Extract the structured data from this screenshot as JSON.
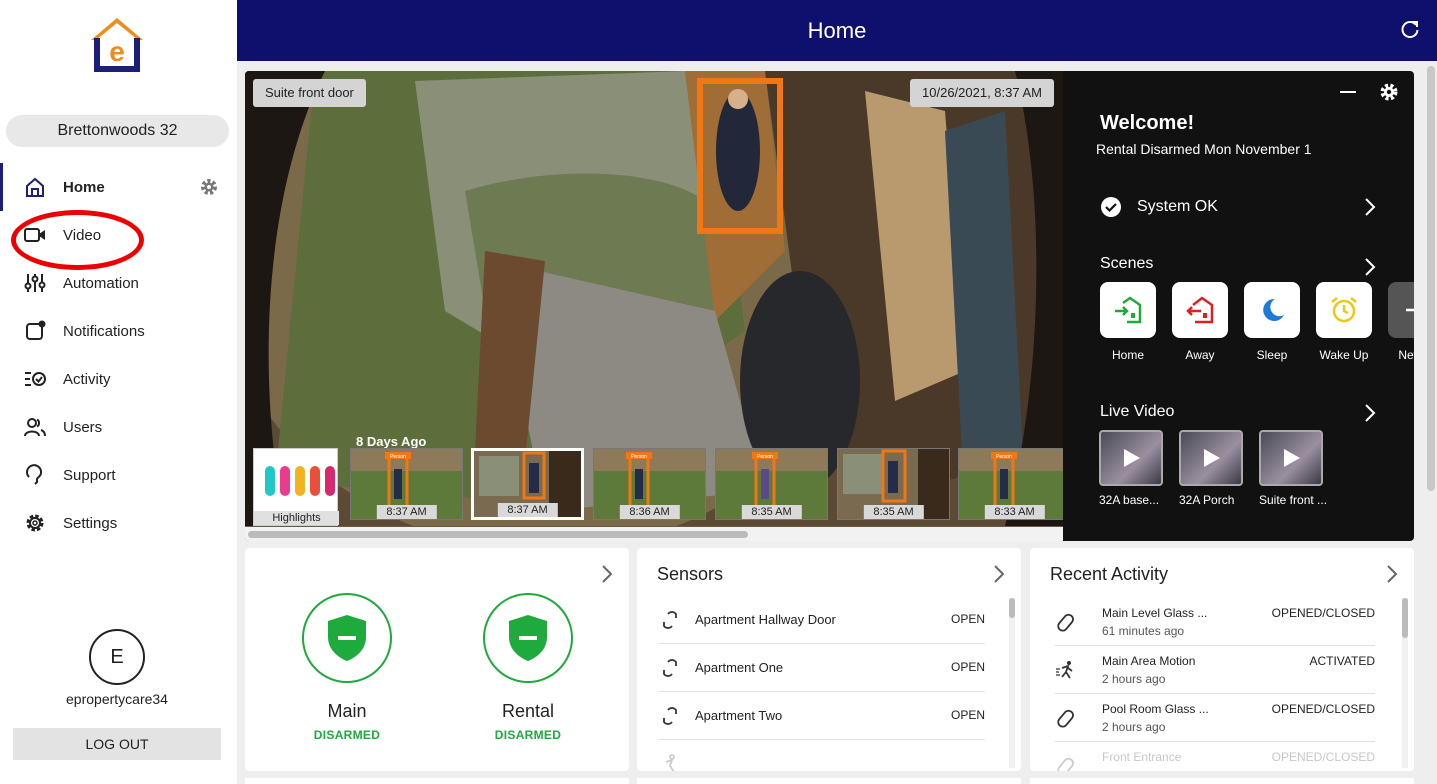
{
  "sidebar": {
    "account": "Brettonwoods 32",
    "items": [
      {
        "label": "Home",
        "icon": "home-icon"
      },
      {
        "label": "Video",
        "icon": "video-camera-icon"
      },
      {
        "label": "Automation",
        "icon": "sliders-icon"
      },
      {
        "label": "Notifications",
        "icon": "notification-icon"
      },
      {
        "label": "Activity",
        "icon": "activity-list-icon"
      },
      {
        "label": "Users",
        "icon": "users-icon"
      },
      {
        "label": "Support",
        "icon": "support-icon"
      },
      {
        "label": "Settings",
        "icon": "gear-icon"
      }
    ],
    "avatar_initial": "E",
    "username": "epropertycare34",
    "logout": "LOG OUT"
  },
  "header": {
    "title": "Home"
  },
  "video": {
    "camera_label": "Suite front door",
    "timestamp": "10/26/2021, 8:37 AM",
    "days_ago": "8 Days Ago",
    "highlights_label": "Highlights",
    "thumbs": [
      {
        "time": "8:37 AM",
        "tag": "Person"
      },
      {
        "time": "8:37 AM",
        "tag": ""
      },
      {
        "time": "8:36 AM",
        "tag": "Person"
      },
      {
        "time": "8:35 AM",
        "tag": "Person"
      },
      {
        "time": "8:35 AM",
        "tag": ""
      },
      {
        "time": "8:33 AM",
        "tag": "Person"
      }
    ]
  },
  "panel": {
    "welcome": "Welcome!",
    "status": "Rental Disarmed Mon November 1",
    "system_ok": "System OK",
    "scenes_title": "Scenes",
    "scenes": [
      {
        "label": "Home",
        "color": "#1eaa3c"
      },
      {
        "label": "Away",
        "color": "#e02020"
      },
      {
        "label": "Sleep",
        "color": "#1e7ad8"
      },
      {
        "label": "Wake Up",
        "color": "#f0c814"
      },
      {
        "label": "New S",
        "color": "#777777"
      }
    ],
    "live_video_title": "Live Video",
    "live_videos": [
      "32A base...",
      "32A Porch",
      "Suite front ..."
    ]
  },
  "partitions": [
    {
      "name": "Main",
      "state": "DISARMED"
    },
    {
      "name": "Rental",
      "state": "DISARMED"
    }
  ],
  "sensors": {
    "title": "Sensors",
    "rows": [
      {
        "name": "Apartment Hallway Door",
        "value": "OPEN"
      },
      {
        "name": "Apartment One",
        "value": "OPEN"
      },
      {
        "name": "Apartment Two",
        "value": "OPEN"
      }
    ]
  },
  "activity": {
    "title": "Recent Activity",
    "rows": [
      {
        "name": "Main Level Glass ...",
        "time": "61 minutes ago",
        "value": "OPENED/CLOSED",
        "icon": "contact-sensor-icon"
      },
      {
        "name": "Main Area Motion",
        "time": "2 hours ago",
        "value": "ACTIVATED",
        "icon": "motion-icon"
      },
      {
        "name": "Pool Room Glass ...",
        "time": "2 hours ago",
        "value": "OPENED/CLOSED",
        "icon": "contact-sensor-icon"
      },
      {
        "name": "Front Entrance",
        "time": "",
        "value": "OPENED/CLOSED",
        "icon": "contact-sensor-icon"
      }
    ]
  }
}
